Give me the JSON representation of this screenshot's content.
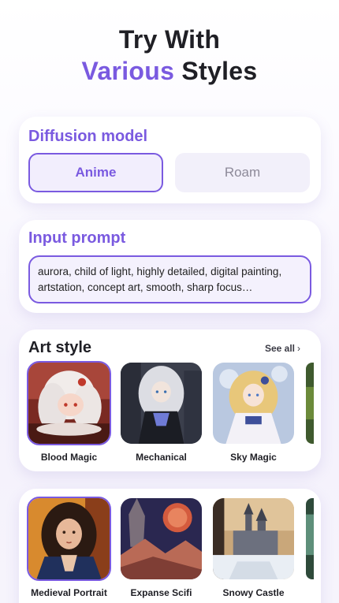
{
  "headline": {
    "line1": "Try With",
    "line2_accent": "Various",
    "line2_rest": " Styles"
  },
  "model": {
    "title": "Diffusion model",
    "options": [
      "Anime",
      "Roam"
    ],
    "selected": "Anime"
  },
  "prompt": {
    "title": "Input prompt",
    "value": "aurora, child of light, highly detailed, digital painting, artstation, concept art, smooth, sharp focus…"
  },
  "art_style": {
    "title": "Art style",
    "see_all": "See all",
    "row1": [
      {
        "label": "Blood Magic",
        "selected": true
      },
      {
        "label": "Mechanical",
        "selected": false
      },
      {
        "label": "Sky Magic",
        "selected": false
      }
    ],
    "row2": [
      {
        "label": "Medieval Portrait",
        "selected": true
      },
      {
        "label": "Expanse Scifi",
        "selected": false
      },
      {
        "label": "Snowy Castle",
        "selected": false
      }
    ]
  },
  "colors": {
    "accent": "#7a5ae0",
    "text": "#1f1f25",
    "muted": "#8d8a99"
  }
}
